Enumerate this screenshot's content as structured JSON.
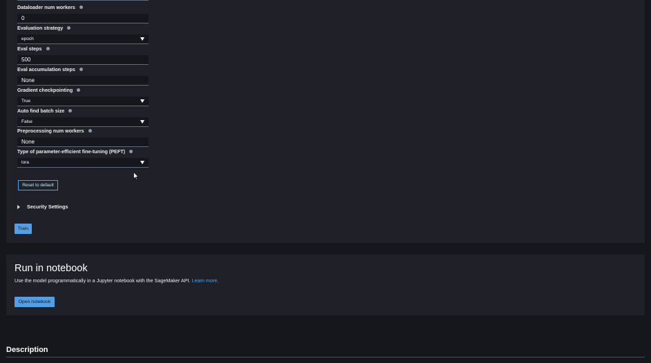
{
  "fields": [
    {
      "label": "Dataloader num workers",
      "type": "input",
      "value": "0"
    },
    {
      "label": "Evaluation strategy",
      "type": "select",
      "value": "epoch"
    },
    {
      "label": "Eval steps",
      "type": "input",
      "value": "500"
    },
    {
      "label": "Eval accumulation steps",
      "type": "input",
      "value": "None"
    },
    {
      "label": "Gradient checkpointing",
      "type": "select",
      "value": "True"
    },
    {
      "label": "Auto find batch size",
      "type": "select",
      "value": "False"
    },
    {
      "label": "Preprocessing num workers",
      "type": "input",
      "value": "None"
    },
    {
      "label": "Type of parameter-efficient fine-tuning (PEFT)",
      "type": "select",
      "value": "lora"
    }
  ],
  "buttons": {
    "reset": "Reset to default",
    "train": "Train",
    "open_notebook": "Open notebook"
  },
  "security": {
    "label": "Security Settings"
  },
  "notebook": {
    "title": "Run in notebook",
    "description": "Use the model programmatically in a Jupyter notebook with the SageMaker API. ",
    "link": "Learn more."
  },
  "description_heading": "Description",
  "colors": {
    "accent": "#539fe5",
    "panel": "#202128",
    "background": "#16171d"
  },
  "icons": [
    "info-icon",
    "chevron-down-icon",
    "chevron-right-icon",
    "mouse-pointer-icon"
  ]
}
